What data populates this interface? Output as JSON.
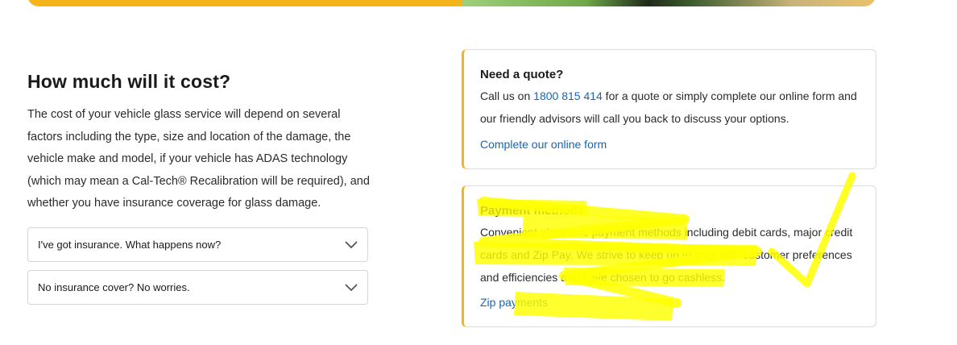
{
  "cost_section": {
    "heading": "How much will it cost?",
    "body": "The cost of your vehicle glass service will depend on several factors including the type, size and location of the damage, the vehicle make and model, if your vehicle has ADAS technology (which may mean a Cal-Tech® Recalibration will be required), and whether you have insurance coverage for glass damage."
  },
  "accordions": [
    {
      "label": "I've got insurance. What happens now?",
      "icon": "chevron-down-icon"
    },
    {
      "label": "No insurance cover? No worries.",
      "icon": "chevron-down-icon"
    }
  ],
  "quote_card": {
    "title": "Need a quote?",
    "text_before_phone": "Call us on ",
    "phone": "1800 815 414",
    "text_after_phone": " for a quote or simply complete our online form and our friendly advisors will call you back to discuss your options.",
    "link": "Complete our online form"
  },
  "payment_card": {
    "title": "Payment methods",
    "text": "Convenient electronic payment methods including debit cards, major credit cards and Zip Pay. We strive to keep up to date with customer preferences and efficiencies and have chosen to go cashless.",
    "link": "Zip payments"
  },
  "colors": {
    "accent": "#f5b41a",
    "link": "#1565b8",
    "highlight": "#ffff00"
  }
}
